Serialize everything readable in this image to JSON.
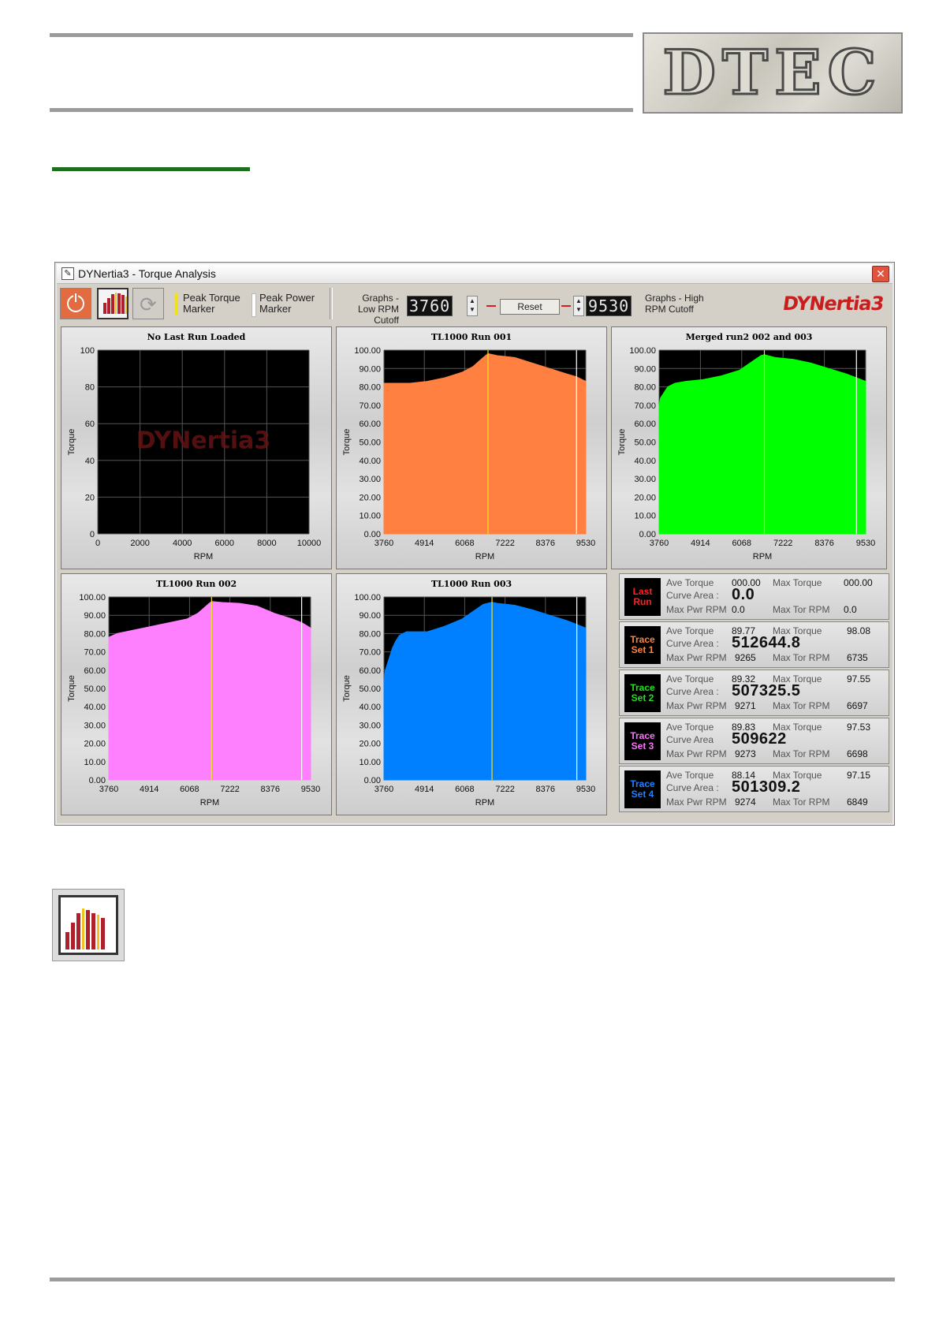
{
  "window": {
    "title": "DYNertia3 - Torque Analysis",
    "close_label": "✕",
    "icon": "feather-icon"
  },
  "toolbar": {
    "peak_torque_marker": "Peak Torque Marker",
    "peak_power_marker": "Peak Power Marker",
    "low_cutoff_label": "Graphs - Low RPM Cutoff",
    "low_cutoff_value": "3760",
    "reset_label": "Reset",
    "high_cutoff_value": "9530",
    "high_cutoff_label": "Graphs - High RPM Cutoff",
    "brand": "DYNertia3",
    "peak_torque_color": "#f0e020",
    "peak_power_color": "#ffffff",
    "power_icon": "power-icon",
    "graph_icon": "bar-graph-icon",
    "refresh_icon": "refresh-icon"
  },
  "charts": {
    "last_run": {
      "title": "No Last Run Loaded",
      "ylabel": "Torque",
      "xlabel": "RPM",
      "watermark": "DYNertia3"
    },
    "run1": {
      "title": "TL1000 Run 001",
      "ylabel": "Torque",
      "xlabel": "RPM"
    },
    "merged": {
      "title": "Merged run2 002 and 003",
      "ylabel": "Torque",
      "xlabel": "RPM"
    },
    "run2": {
      "title": "TL1000 Run 002",
      "ylabel": "Torque",
      "xlabel": "RPM"
    },
    "run3": {
      "title": "TL1000 Run 003",
      "ylabel": "Torque",
      "xlabel": "RPM"
    }
  },
  "chart_data": [
    {
      "type": "line",
      "title": "No Last Run Loaded",
      "xlabel": "RPM",
      "ylabel": "Torque",
      "xlim": [
        0,
        10000
      ],
      "ylim": [
        0,
        100
      ],
      "xticks": [
        "0",
        "2000",
        "4000",
        "6000",
        "8000",
        "10000"
      ],
      "yticks": [
        "0",
        "20",
        "40",
        "60",
        "80",
        "100"
      ],
      "grid": true,
      "series": []
    },
    {
      "type": "area",
      "title": "TL1000 Run 001",
      "xlabel": "RPM",
      "ylabel": "Torque",
      "xlim": [
        3760,
        9530
      ],
      "ylim": [
        0,
        100
      ],
      "xticks": [
        "3760",
        "4914",
        "6068",
        "7222",
        "8376",
        "9530"
      ],
      "yticks": [
        "0.00",
        "10.00",
        "20.00",
        "30.00",
        "40.00",
        "50.00",
        "60.00",
        "70.00",
        "80.00",
        "90.00",
        "100.00"
      ],
      "color": "#ff8040",
      "x": [
        3760,
        4000,
        4500,
        5000,
        5500,
        6000,
        6300,
        6600,
        6735,
        7000,
        7500,
        8000,
        8500,
        9000,
        9265,
        9530
      ],
      "y": [
        82,
        82,
        82,
        83,
        85,
        88,
        91,
        96,
        98.08,
        97,
        96,
        93,
        90,
        87,
        85.5,
        83
      ],
      "markers": {
        "peak_torque_rpm": 6735,
        "peak_power_rpm": 9265
      }
    },
    {
      "type": "area",
      "title": "Merged run2 002 and 003",
      "xlabel": "RPM",
      "ylabel": "Torque",
      "xlim": [
        3760,
        9530
      ],
      "ylim": [
        0,
        100
      ],
      "xticks": [
        "3760",
        "4914",
        "6068",
        "7222",
        "8376",
        "9530"
      ],
      "yticks": [
        "0.00",
        "10.00",
        "20.00",
        "30.00",
        "40.00",
        "50.00",
        "60.00",
        "70.00",
        "80.00",
        "90.00",
        "100.00"
      ],
      "color": "#00ff00",
      "x": [
        3760,
        3800,
        3900,
        4000,
        4200,
        4500,
        5000,
        5500,
        6000,
        6300,
        6600,
        6700,
        7000,
        7500,
        8000,
        8500,
        9000,
        9270,
        9530
      ],
      "y": [
        70,
        74,
        77,
        80,
        82,
        83,
        84,
        86,
        89,
        93,
        97,
        97.5,
        96,
        95,
        93,
        90,
        87,
        85,
        83
      ],
      "markers": {
        "peak_torque_rpm": 6700,
        "peak_power_rpm": 9272
      }
    },
    {
      "type": "area",
      "title": "TL1000 Run 002",
      "xlabel": "RPM",
      "ylabel": "Torque",
      "xlim": [
        3760,
        9530
      ],
      "ylim": [
        0,
        100
      ],
      "xticks": [
        "3760",
        "4914",
        "6068",
        "7222",
        "8376",
        "9530"
      ],
      "yticks": [
        "0.00",
        "10.00",
        "20.00",
        "30.00",
        "40.00",
        "50.00",
        "60.00",
        "70.00",
        "80.00",
        "90.00",
        "100.00"
      ],
      "color": "#ff80ff",
      "x": [
        3760,
        4000,
        4500,
        5000,
        5500,
        6000,
        6300,
        6600,
        6698,
        7000,
        7500,
        8000,
        8500,
        9000,
        9273,
        9530
      ],
      "y": [
        78,
        80,
        82,
        84,
        86,
        88,
        91,
        96,
        97.53,
        97,
        96.5,
        95,
        91,
        88,
        86,
        83
      ],
      "markers": {
        "peak_torque_rpm": 6698,
        "peak_power_rpm": 9273
      }
    },
    {
      "type": "area",
      "title": "TL1000 Run 003",
      "xlabel": "RPM",
      "ylabel": "Torque",
      "xlim": [
        3760,
        9530
      ],
      "ylim": [
        0,
        100
      ],
      "xticks": [
        "3760",
        "4914",
        "6068",
        "7222",
        "8376",
        "9530"
      ],
      "yticks": [
        "0.00",
        "10.00",
        "20.00",
        "30.00",
        "40.00",
        "50.00",
        "60.00",
        "70.00",
        "80.00",
        "90.00",
        "100.00"
      ],
      "color": "#0080ff",
      "x": [
        3760,
        3800,
        3900,
        4000,
        4100,
        4200,
        4400,
        5000,
        5500,
        6000,
        6300,
        6600,
        6849,
        7000,
        7500,
        8000,
        8500,
        9000,
        9274,
        9530
      ],
      "y": [
        55,
        60,
        66,
        72,
        76,
        79,
        81,
        81,
        84,
        88,
        92,
        96,
        97.15,
        96.5,
        95.5,
        93,
        90,
        87,
        85,
        83
      ],
      "markers": {
        "peak_torque_rpm": 6849,
        "peak_power_rpm": 9274
      }
    }
  ],
  "stats": {
    "labels": {
      "ave_torque": "Ave Torque",
      "max_torque": "Max Torque",
      "max_torque_short": "Max Torque",
      "curve_area": "Curve Area :",
      "curve_area_plain": "Curve Area",
      "max_pwr_rpm": "Max Pwr RPM",
      "max_tor_rpm": "Max Tor RPM"
    },
    "rows": [
      {
        "badge": "Last Run",
        "badge_color": "#ff2020",
        "ave_torque": "000.00",
        "max_torque": "000.00",
        "curve_area": "0.0",
        "max_pwr_rpm": "0.0",
        "max_tor_rpm": "0.0"
      },
      {
        "badge": "Trace Set 1",
        "badge_color": "#ff8040",
        "ave_torque": "89.77",
        "max_torque": "98.08",
        "curve_area": "512644.8",
        "max_pwr_rpm": "9265",
        "max_tor_rpm": "6735"
      },
      {
        "badge": "Trace Set 2",
        "badge_color": "#20e020",
        "ave_torque": "89.32",
        "max_torque": "97.55",
        "curve_area": "507325.5",
        "max_pwr_rpm": "9271",
        "max_tor_rpm": "6697"
      },
      {
        "badge": "Trace Set 3",
        "badge_color": "#ff70ff",
        "ave_torque": "89.83",
        "max_torque": "97.53",
        "curve_area": "509622",
        "max_pwr_rpm": "9273",
        "max_tor_rpm": "6698"
      },
      {
        "badge": "Trace Set 4",
        "badge_color": "#2080ff",
        "ave_torque": "88.14",
        "max_torque": "97.15",
        "curve_area": "501309.2",
        "max_pwr_rpm": "9274",
        "max_tor_rpm": "6849"
      }
    ]
  },
  "header": {
    "logo_text": "DTEC"
  },
  "page_icon": {
    "name": "graph-analysis-icon"
  }
}
